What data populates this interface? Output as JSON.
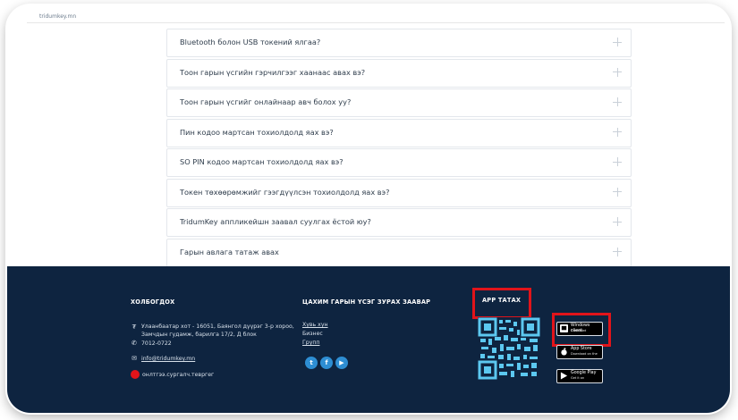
{
  "urlbar": {
    "text": "tridumkey.mn"
  },
  "faq": {
    "items": [
      {
        "question": "Bluetooth болон USB токений ялгаа?"
      },
      {
        "question": "Тоон гарын үсгийн гэрчилгээг хаанаас авах вэ?"
      },
      {
        "question": "Тоон гарын үсгийг онлайнаар авч болох уу?"
      },
      {
        "question": "Пин кодоо мартсан тохиолдолд яах вэ?"
      },
      {
        "question": "SO PIN кодоо мартсан тохиолдолд яах вэ?"
      },
      {
        "question": "Токен төхөөрөмжийг гээгдүүлсэн тохиолдолд яах вэ?"
      },
      {
        "question": "TridumKey аппликейшн заавал суулгах ёстой юу?"
      },
      {
        "question": "Гарын авлага татаж авах"
      }
    ]
  },
  "footer": {
    "contact": {
      "title": "ХОЛБОГДОХ",
      "address": "Улаанбаатар хот - 16051, Баянгол дүүрэг 3-р хороо, Замчдын гудамж, барилга 17/2, Д блок",
      "phone": "7012-0722",
      "email": "info@tridumkey.mn",
      "google": "онлтгээ.сургалч.тевргег"
    },
    "guide": {
      "title": "ЦАХИМ ГАРЫН ҮСЭГ ЗУРАХ ЗААВАР",
      "links": [
        "Хувь хүн",
        "Бизнес",
        "Групп"
      ]
    },
    "apps": {
      "title": "APP ТАТАХ",
      "stores": [
        {
          "name": "Windows client",
          "sub": "Download"
        },
        {
          "name": "App Store",
          "sub": "Download on the"
        },
        {
          "name": "Google Play",
          "sub": "Get it on"
        }
      ]
    },
    "social": [
      "twitter-icon",
      "facebook-icon",
      "youtube-icon"
    ]
  },
  "colors": {
    "footer_bg": "#0e2440",
    "accent": "#2e8ed3",
    "highlight": "#e1141a"
  }
}
